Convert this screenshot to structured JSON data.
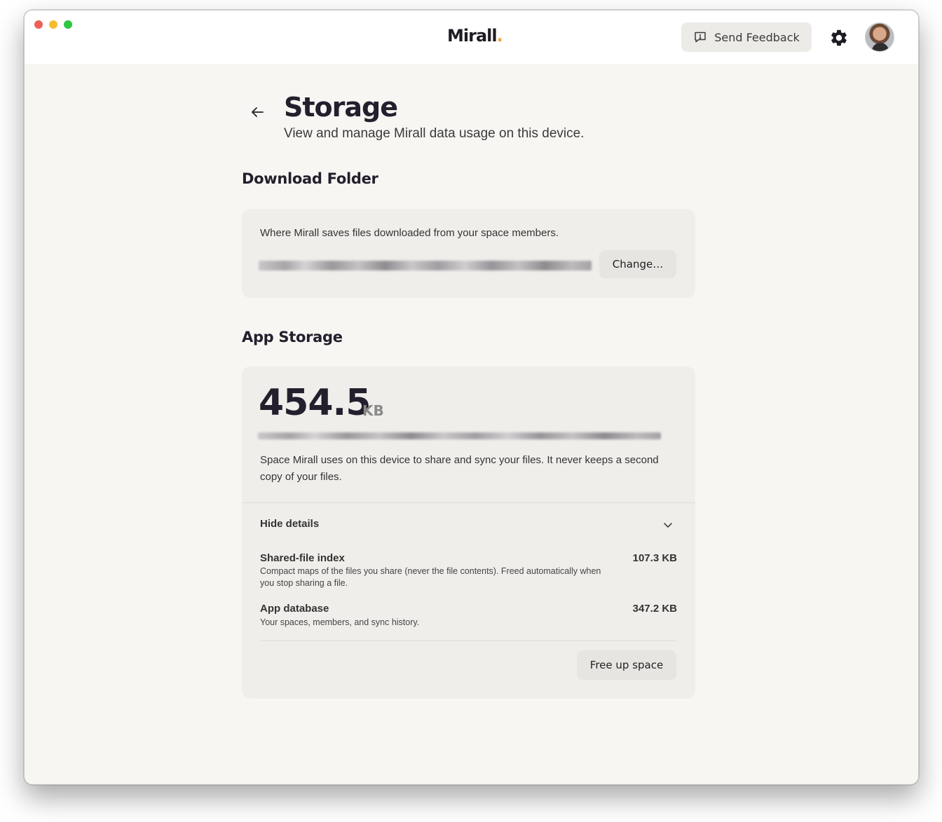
{
  "app": {
    "logo_text": "Mirall",
    "logo_dot": ".",
    "feedback_label": "Send Feedback"
  },
  "page": {
    "title": "Storage",
    "subtitle": "View and manage Mirall data usage on this device."
  },
  "download_folder": {
    "section_title": "Download Folder",
    "description": "Where Mirall saves files downloaded from your space members.",
    "change_label": "Change…"
  },
  "app_storage": {
    "section_title": "App Storage",
    "total_value": "454.5",
    "total_unit": "KB",
    "description": "Space Mirall uses on this device to share and sync your files. It never keeps a second copy of your files.",
    "details_toggle_label": "Hide details",
    "items": [
      {
        "title": "Shared-file index",
        "description": "Compact maps of the files you share (never the file contents). Freed automatically when you stop sharing a file.",
        "size": "107.3 KB"
      },
      {
        "title": "App database",
        "description": "Your spaces, members, and sync history.",
        "size": "347.2 KB"
      }
    ],
    "free_up_label": "Free up space"
  },
  "icons": {
    "feedback": "message-alert-icon",
    "settings": "gear-icon",
    "back": "arrow-left-icon",
    "toggle": "chevron-down-icon"
  },
  "colors": {
    "logo_accent": "#f0a23a",
    "window_bg": "#f7f6f3",
    "card_bg": "#efeeeb",
    "title_text": "#231f2c"
  }
}
